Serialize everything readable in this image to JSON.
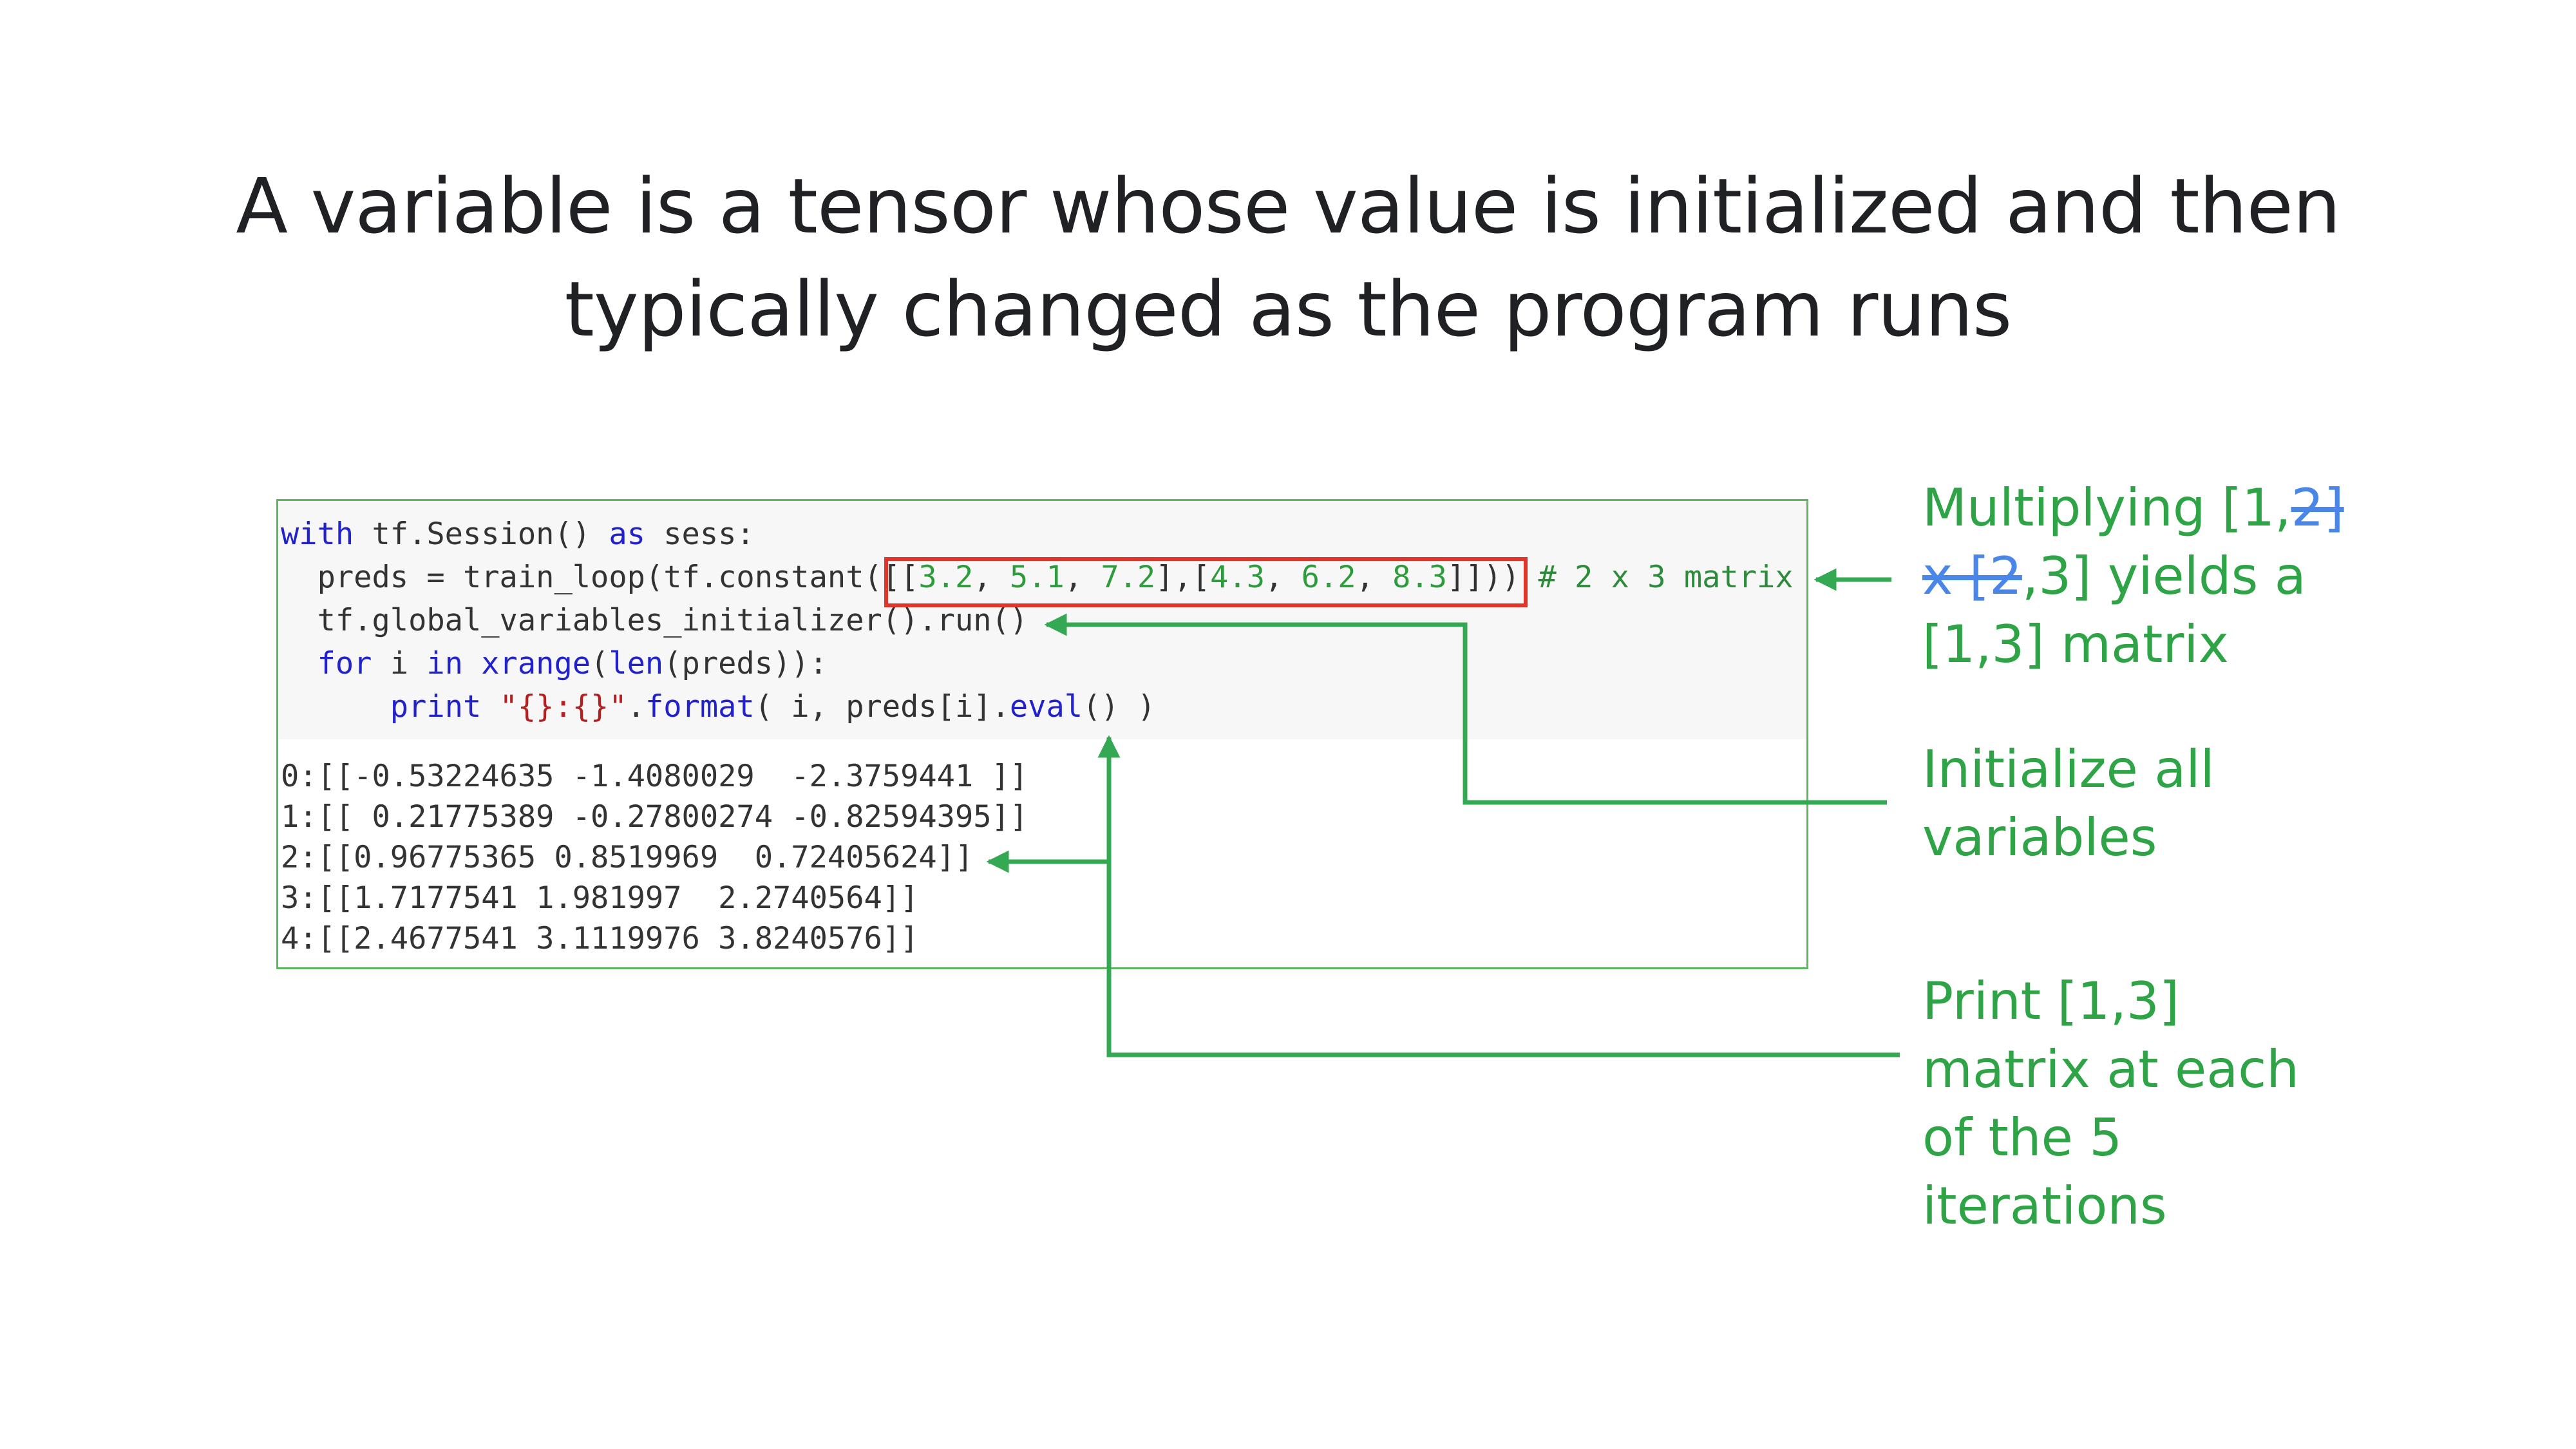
{
  "title": {
    "line1": "A variable is a tensor whose value is initialized and then",
    "line2": "typically changed as the program runs"
  },
  "code": {
    "l1_kw1": "with",
    "l1_mid": " tf.Session() ",
    "l1_kw2": "as",
    "l1_end": " sess:",
    "l2_pre": "  preds = train_loop(tf.constant(",
    "l2_b1": "[[",
    "l2_n1": "3.2",
    "l2_c1": ", ",
    "l2_n2": "5.1",
    "l2_c2": ", ",
    "l2_n3": "7.2",
    "l2_b2": "],[",
    "l2_n4": "4.3",
    "l2_c3": ", ",
    "l2_n5": "6.2",
    "l2_c4": ", ",
    "l2_n6": "8.3",
    "l2_b3": "]]",
    "l2_close": "))",
    "l2_comment": " # 2 x 3 matrix",
    "l3": "  tf.global_variables_initializer().run()",
    "l4_pad": "  ",
    "l4_kw1": "for",
    "l4_mid": " i ",
    "l4_kw2": "in",
    "l4_sp": " ",
    "l4_kw3": "xrange",
    "l4_p1": "(",
    "l4_kw4": "len",
    "l4_end": "(preds)):",
    "l5_pad": "      ",
    "l5_kw": "print",
    "l5_sp": " ",
    "l5_str": "\"{}:{}\"",
    "l5_dot": ".",
    "l5_fmt": "format",
    "l5_mid": "( i, preds[i].",
    "l5_eval": "eval",
    "l5_end": "() )"
  },
  "output": [
    "0:[[-0.53224635 -1.4080029  -2.3759441 ]]",
    "1:[[ 0.21775389 -0.27800274 -0.82594395]]",
    "2:[[0.96775365 0.8519969  0.72405624]]",
    "3:[[1.7177541 1.981997  2.2740564]]",
    "4:[[2.4677541 3.1119976 3.8240576]]"
  ],
  "annotations": {
    "multiply": {
      "part1": "Multiplying [1,",
      "strike1": "2]",
      "strike2": "x [2",
      "part2": ",3] yields a",
      "part3": "[1,3] matrix"
    },
    "init": {
      "line1": "Initialize all",
      "line2": "variables"
    },
    "print": {
      "line1": "Print [1,3]",
      "line2": "matrix at each",
      "line3": "of the 5",
      "line4": "iterations"
    }
  },
  "colors": {
    "title": "#202124",
    "annotation_green": "#2ea446",
    "strike_blue": "#4a86e8",
    "highlight_red": "#e0352b",
    "panel_border": "#5cb85c"
  }
}
